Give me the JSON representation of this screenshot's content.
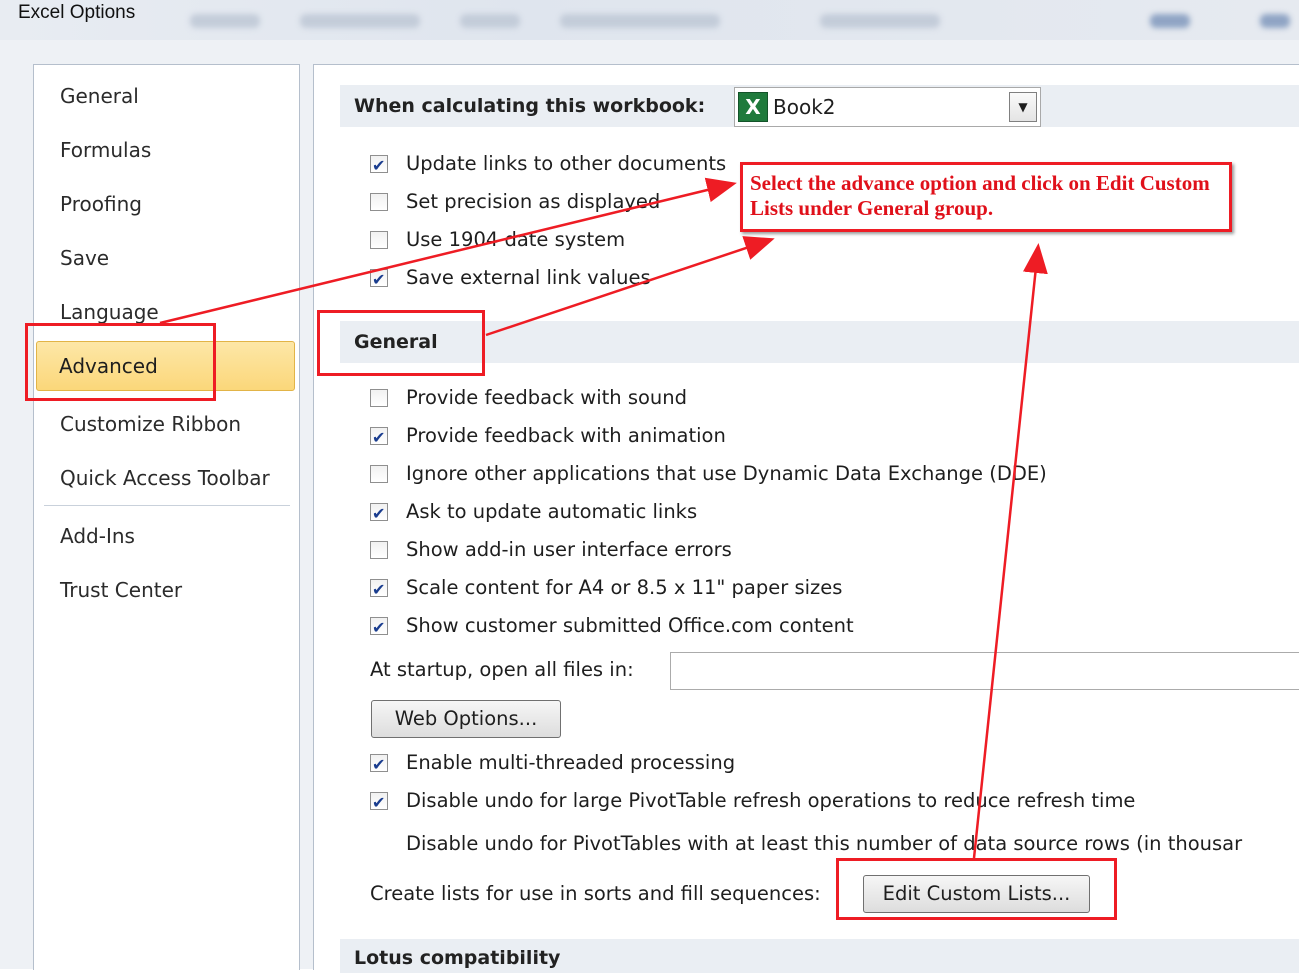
{
  "window": {
    "title": "Excel Options"
  },
  "nav": {
    "items": [
      {
        "label": "General"
      },
      {
        "label": "Formulas"
      },
      {
        "label": "Proofing"
      },
      {
        "label": "Save"
      },
      {
        "label": "Language"
      },
      {
        "label": "Advanced",
        "selected": true
      },
      {
        "label": "Customize Ribbon"
      },
      {
        "label": "Quick Access Toolbar"
      },
      {
        "label": "Add-Ins"
      },
      {
        "label": "Trust Center"
      }
    ]
  },
  "workbook_section": {
    "label": "When calculating this workbook:",
    "selected_workbook": "Book2",
    "options": [
      {
        "label": "Update links to other documents",
        "checked": true
      },
      {
        "label": "Set precision as displayed",
        "checked": false
      },
      {
        "label": "Use 1904 date system",
        "checked": false
      },
      {
        "label": "Save external link values",
        "checked": true
      }
    ]
  },
  "general_section": {
    "header": "General",
    "options": [
      {
        "label": "Provide feedback with sound",
        "checked": false
      },
      {
        "label": "Provide feedback with animation",
        "checked": true
      },
      {
        "label": "Ignore other applications that use Dynamic Data Exchange (DDE)",
        "checked": false
      },
      {
        "label": "Ask to update automatic links",
        "checked": true
      },
      {
        "label": "Show add-in user interface errors",
        "checked": false
      },
      {
        "label": "Scale content for A4 or 8.5 x 11\" paper sizes",
        "checked": true
      },
      {
        "label": "Show customer submitted Office.com content",
        "checked": true
      }
    ],
    "startup_label": "At startup, open all files in:",
    "startup_value": "",
    "web_options_button": "Web Options...",
    "processing_options": [
      {
        "label": "Enable multi-threaded processing",
        "checked": true
      },
      {
        "label": "Disable undo for large PivotTable refresh operations to reduce refresh time",
        "checked": true
      }
    ],
    "pivot_rows_label": "Disable undo for PivotTables with at least this number of data source rows (in thousar",
    "custom_lists_label": "Create lists for use in sorts and fill sequences:",
    "edit_custom_lists_button": "Edit Custom Lists..."
  },
  "lotus_section": {
    "header": "Lotus compatibility"
  },
  "annotation": {
    "text": "Select the advance option and click on Edit Custom Lists under General group.",
    "color": "#ee1c24"
  },
  "colors": {
    "selected_nav": "#fbd77a",
    "section_header": "#eaeef3",
    "annotation_red": "#ee1c24"
  }
}
